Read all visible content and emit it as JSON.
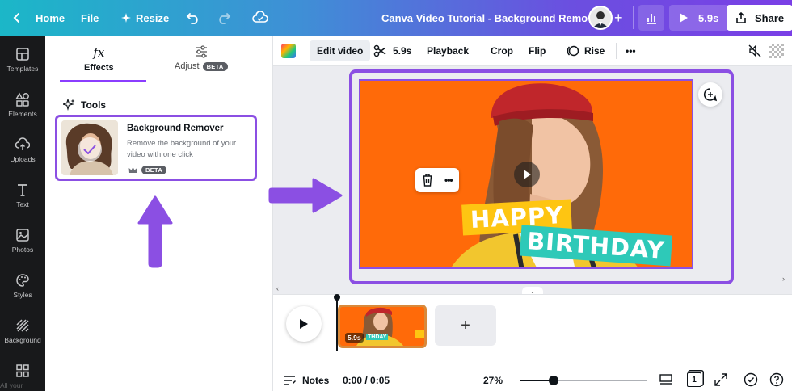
{
  "topbar": {
    "home_label": "Home",
    "file_label": "File",
    "resize_label": "Resize",
    "title": "Canva Video Tutorial - Background Remover",
    "plus": "+",
    "present_duration": "5.9s",
    "share_label": "Share"
  },
  "rail": {
    "items": [
      {
        "label": "Templates",
        "icon": "template-icon"
      },
      {
        "label": "Elements",
        "icon": "elements-icon"
      },
      {
        "label": "Uploads",
        "icon": "upload-icon"
      },
      {
        "label": "Text",
        "icon": "text-icon"
      },
      {
        "label": "Photos",
        "icon": "photos-icon"
      },
      {
        "label": "Styles",
        "icon": "styles-icon"
      },
      {
        "label": "Background",
        "icon": "background-icon"
      },
      {
        "label": "All your designs",
        "icon": "grid-icon"
      }
    ]
  },
  "panel": {
    "tab_effects": "Effects",
    "tab_effects_glyph": "fx",
    "tab_adjust": "Adjust",
    "beta": "BETA",
    "tools_heading": "Tools",
    "card": {
      "title": "Background Remover",
      "description": "Remove the background of your video with one click",
      "badge": "BETA"
    }
  },
  "editor_toolbar": {
    "edit_video": "Edit video",
    "trim_duration": "5.9s",
    "playback": "Playback",
    "crop": "Crop",
    "flip": "Flip",
    "animation": "Rise",
    "more": "•••"
  },
  "canvas": {
    "text1": "HAPPY",
    "text2": "BIRTHDAY",
    "more_dots": "•••"
  },
  "timeline": {
    "clip_duration": "5.9s",
    "clip_text": "THDAY",
    "add": "+",
    "notes": "Notes",
    "time": "0:00 / 0:05",
    "zoom": "27%",
    "page_number": "1",
    "zoom_level_fraction": 0.26
  },
  "colors": {
    "accent": "#8b4fe3",
    "video_bg": "#ff6a09",
    "happy_bg": "#fec512",
    "birthday_bg": "#2ec9b8"
  }
}
